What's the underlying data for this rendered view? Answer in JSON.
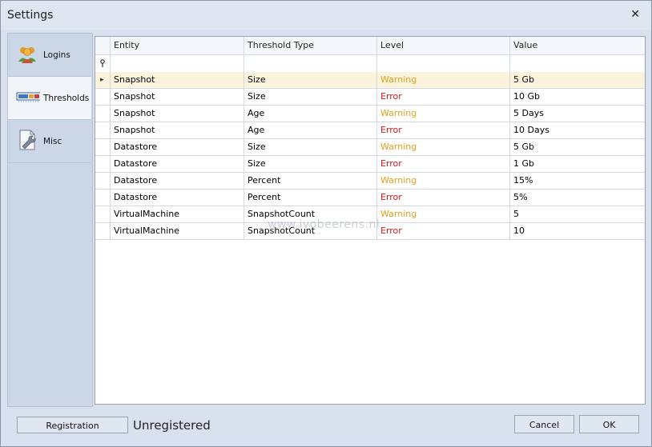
{
  "window": {
    "title": "Settings",
    "close_glyph": "✕"
  },
  "nav": {
    "items": [
      {
        "label": "Logins",
        "icon": "users-icon",
        "active": false
      },
      {
        "label": "Thresholds",
        "icon": "threshold-meter-icon",
        "active": true
      },
      {
        "label": "Misc",
        "icon": "wrench-document-icon",
        "active": false
      }
    ]
  },
  "grid": {
    "columns": [
      "Entity",
      "Threshold Type",
      "Level",
      "Value"
    ],
    "filter_icon": "filter-pin-icon",
    "row_indicator": "▸",
    "rows": [
      {
        "entity": "Snapshot",
        "type": "Size",
        "level": "Warning",
        "value": "5 Gb",
        "selected": true
      },
      {
        "entity": "Snapshot",
        "type": "Size",
        "level": "Error",
        "value": "10 Gb"
      },
      {
        "entity": "Snapshot",
        "type": "Age",
        "level": "Warning",
        "value": "5 Days"
      },
      {
        "entity": "Snapshot",
        "type": "Age",
        "level": "Error",
        "value": "10 Days"
      },
      {
        "entity": "Datastore",
        "type": "Size",
        "level": "Warning",
        "value": "5 Gb"
      },
      {
        "entity": "Datastore",
        "type": "Size",
        "level": "Error",
        "value": "1 Gb"
      },
      {
        "entity": "Datastore",
        "type": "Percent",
        "level": "Warning",
        "value": "15%"
      },
      {
        "entity": "Datastore",
        "type": "Percent",
        "level": "Error",
        "value": "5%"
      },
      {
        "entity": "VirtualMachine",
        "type": "SnapshotCount",
        "level": "Warning",
        "value": "5"
      },
      {
        "entity": "VirtualMachine",
        "type": "SnapshotCount",
        "level": "Error",
        "value": "10"
      }
    ],
    "level_colors": {
      "Warning": "#e2a01a",
      "Error": "#d01818"
    }
  },
  "watermark": "www.ivobeerens.nl",
  "footer": {
    "registration_label": "Registration",
    "status_text": "Unregistered",
    "cancel_label": "Cancel",
    "ok_label": "OK"
  }
}
